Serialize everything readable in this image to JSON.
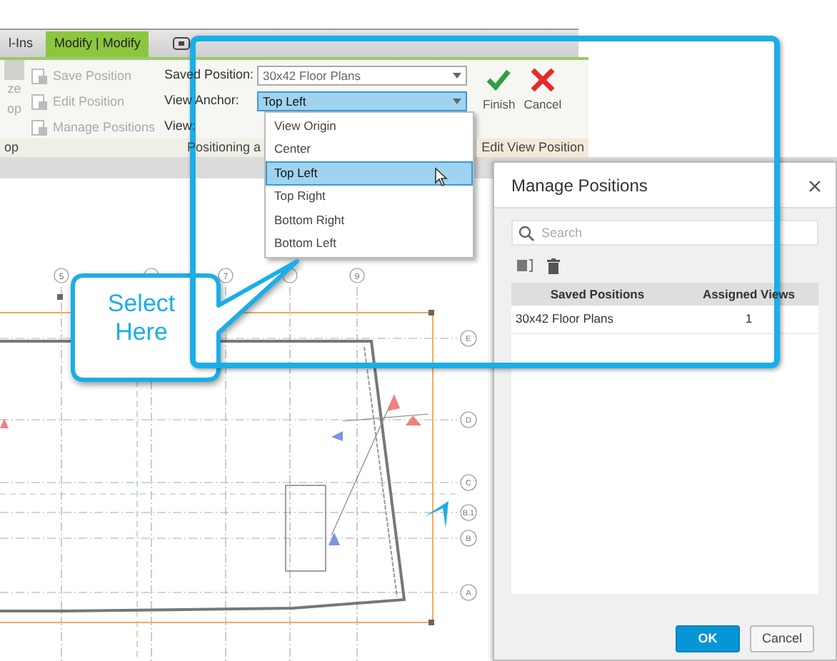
{
  "ribbon_tabs": [
    {
      "label": "l-Ins",
      "selected": false
    },
    {
      "label": "Modify | Modify",
      "selected": true
    }
  ],
  "ribbon": {
    "left_tool": {
      "label_lines": [
        "ze",
        "op"
      ]
    },
    "tools": [
      {
        "label": "Save Position",
        "disabled": true
      },
      {
        "label": "Edit Position",
        "disabled": true
      },
      {
        "label": "Manage Positions",
        "disabled": true
      }
    ],
    "fields": [
      {
        "label": "Saved Position:",
        "value": "30x42 Floor Plans",
        "focused": false
      },
      {
        "label": "View Anchor:",
        "value": "Top Left",
        "focused": true
      },
      {
        "label": "View:"
      }
    ],
    "actions": [
      {
        "kind": "finish",
        "label": "Finish"
      },
      {
        "kind": "cancel",
        "label": "Cancel"
      }
    ],
    "panel_labels": [
      {
        "label": "op",
        "kind": "plain"
      },
      {
        "label": "Positioning a",
        "kind": "plain"
      },
      {
        "label": "Edit View Position",
        "kind": "context"
      }
    ]
  },
  "anchor_dropdown": {
    "options": [
      {
        "label": "View Origin",
        "selected": false
      },
      {
        "label": "Center",
        "selected": false
      },
      {
        "label": "Top Left",
        "selected": true
      },
      {
        "label": "Top Right",
        "selected": false
      },
      {
        "label": "Bottom Right",
        "selected": false
      },
      {
        "label": "Bottom Left",
        "selected": false
      }
    ]
  },
  "plan": {
    "column_labels": [
      "5",
      "7",
      "9"
    ],
    "row_labels": [
      "E",
      "D",
      "C",
      "B.1",
      "B",
      "A"
    ]
  },
  "callout": {
    "text": "Select Here"
  },
  "dialog": {
    "title": "Manage Positions",
    "search": {
      "placeholder": "Search"
    },
    "table": {
      "columns": [
        "Saved Positions",
        "Assigned Views"
      ],
      "rows": [
        [
          "30x42 Floor Plans",
          "1"
        ]
      ]
    },
    "buttons": [
      {
        "label": "OK",
        "kind": "primary"
      },
      {
        "label": "Cancel",
        "kind": "secondary"
      }
    ]
  }
}
